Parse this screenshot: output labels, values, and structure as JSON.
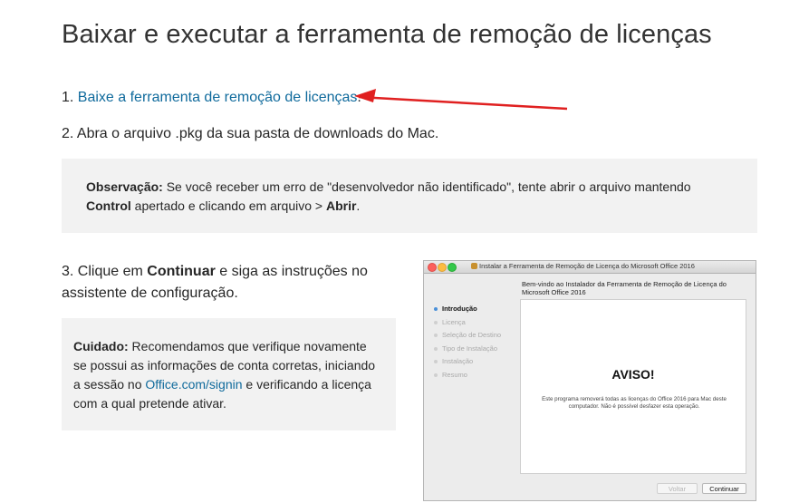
{
  "page": {
    "title": "Baixar e executar a ferramenta de remoção de licenças"
  },
  "steps": {
    "step1_number": "1.",
    "step1_link": "Baixe a ferramenta de remoção de licenças",
    "step1_suffix": ".",
    "step2_text": "2. Abra o arquivo .pkg da sua pasta de downloads do Mac.",
    "step3_prefix": "3. Clique em ",
    "step3_bold": "Continuar",
    "step3_suffix": " e siga as instruções no assistente de configuração."
  },
  "note": {
    "label": "Observação:",
    "text1": " Se você receber um erro de \"desenvolvedor não identificado\", tente abrir o arquivo mantendo ",
    "bold1": "Control",
    "text2": " apertado e clicando em arquivo > ",
    "bold2": "Abrir",
    "text3": "."
  },
  "caution": {
    "label": "Cuidado:",
    "text1": " Recomendamos que verifique novamente se possui as informações de conta corretas, iniciando a sessão no ",
    "link": "Office.com/signin",
    "text2": " e verificando a licença com a qual pretende ativar."
  },
  "installer": {
    "window_title": "Instalar a Ferramenta de Remoção de Licença do Microsoft Office 2016",
    "heading": "Bem-vindo ao Instalador da Ferramenta de Remoção de Licença do Microsoft Office 2016",
    "steps": [
      "Introdução",
      "Licença",
      "Seleção de Destino",
      "Tipo de Instalação",
      "Instalação",
      "Resumo"
    ],
    "active_step": "Introdução",
    "warning_title": "AVISO!",
    "warning_text": "Este programa removerá todas as licenças do Office 2016 para Mac deste computador. Não é possível desfazer esta operação.",
    "back_button": "Voltar",
    "continue_button": "Continuar"
  },
  "colors": {
    "link": "#0f6a9c",
    "callout_bg": "#f2f2f2",
    "arrow": "#e02020"
  }
}
